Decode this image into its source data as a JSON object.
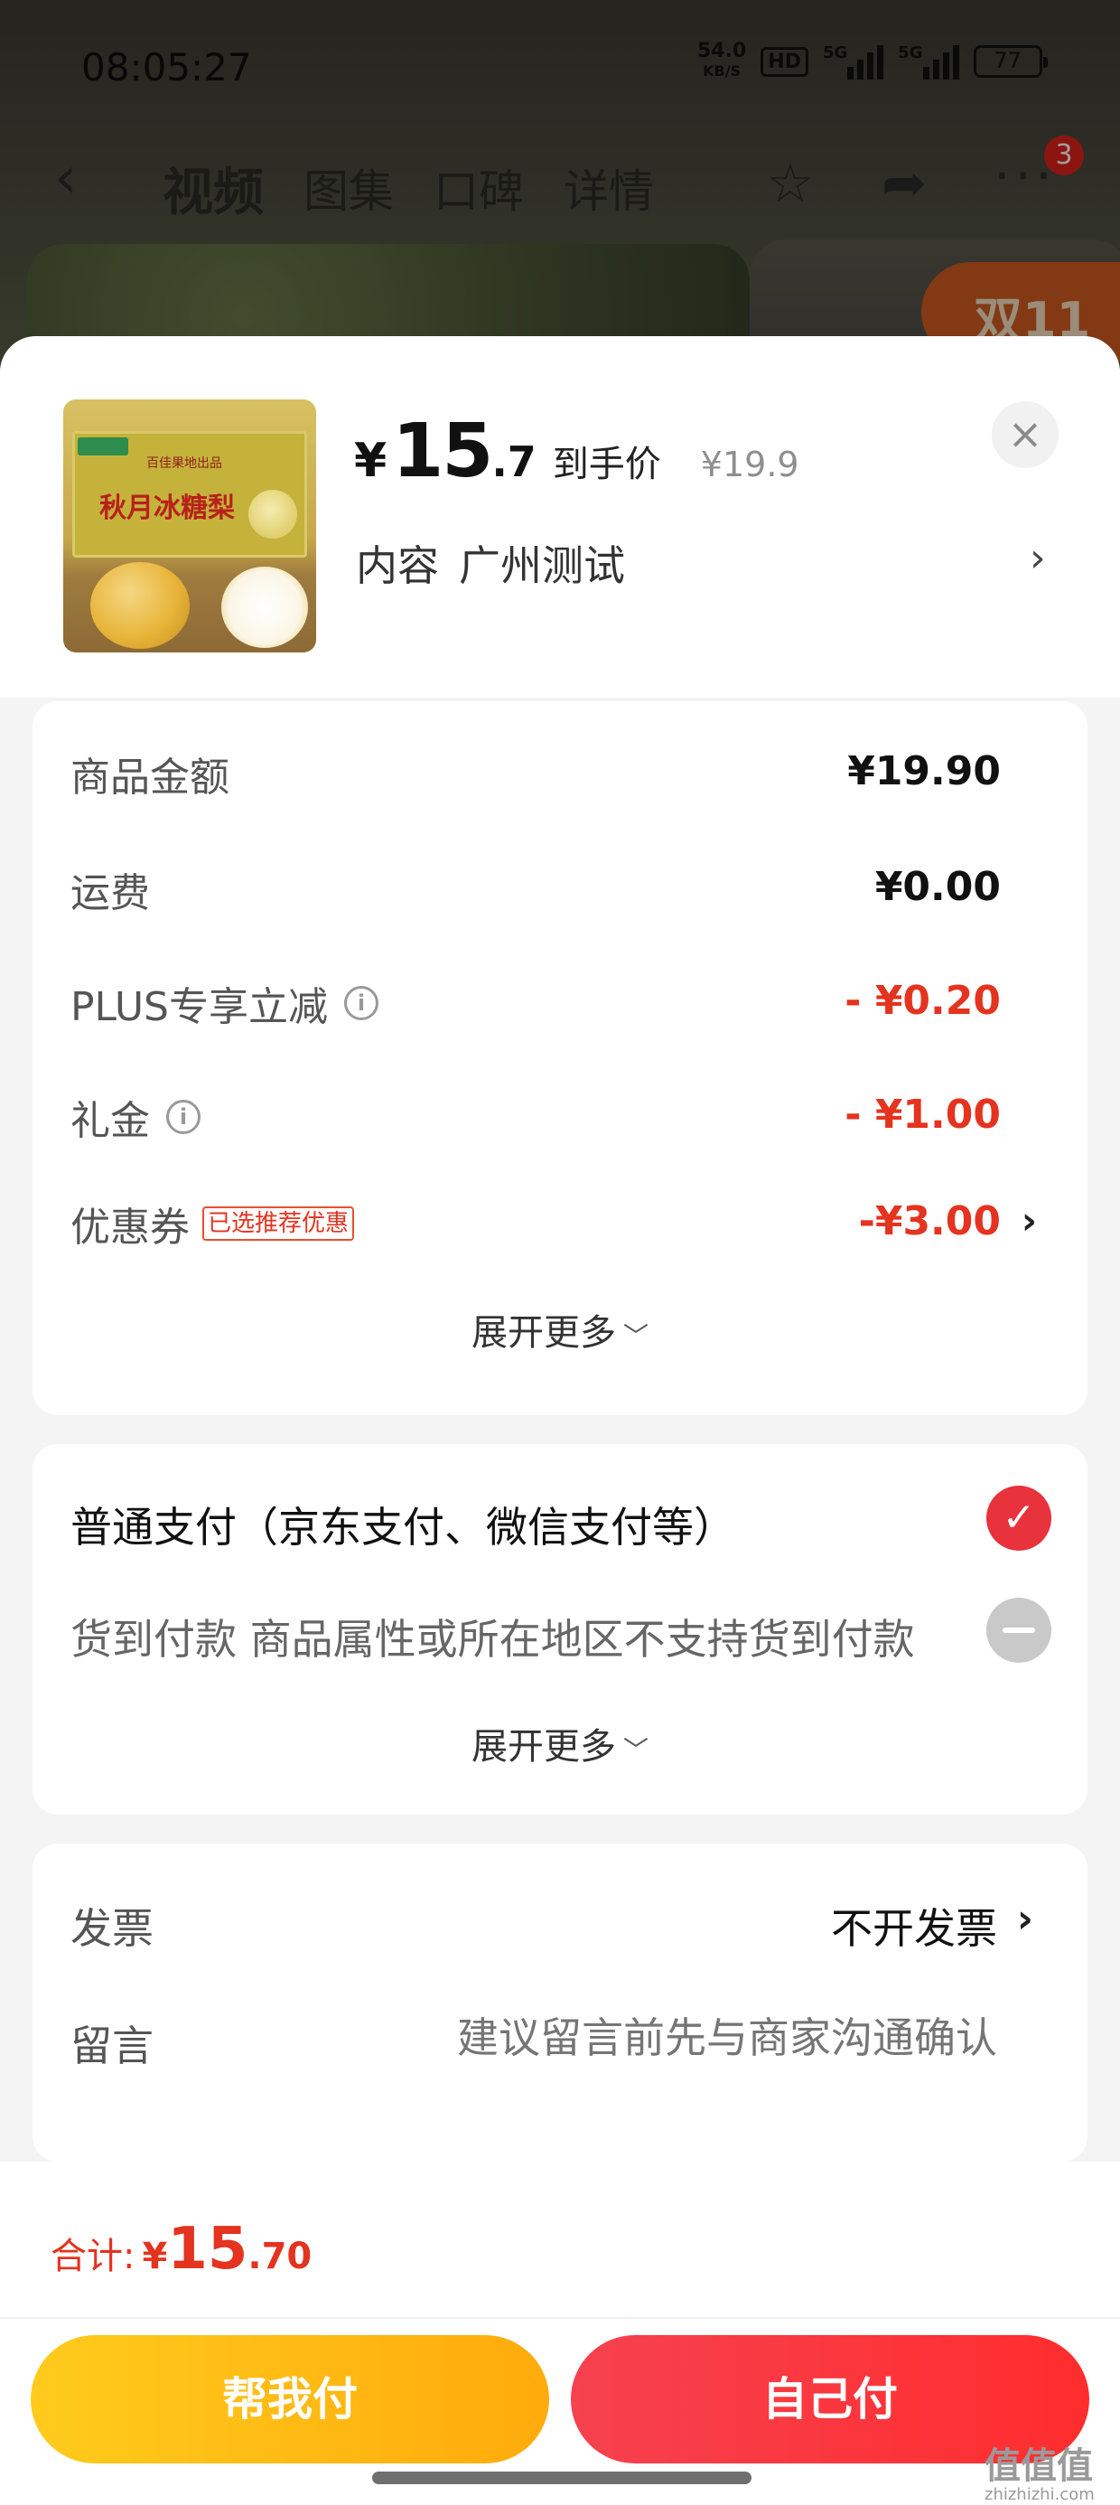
{
  "status_bar": {
    "time": "08:05:27",
    "net_speed": "54.0",
    "net_unit": "KB/S",
    "hd": "HD",
    "sig1": "5G",
    "sig2": "5G",
    "battery": "77"
  },
  "nav": {
    "tabs": [
      {
        "label": "视频"
      },
      {
        "label": "图集"
      },
      {
        "label": "口碑"
      },
      {
        "label": "详情"
      }
    ],
    "more_count": "3",
    "bg_badge": "双11"
  },
  "product": {
    "image_title": "秋月冰糖梨",
    "image_subtitle": "百佳果地出品",
    "price_symbol": "¥",
    "price_int": "15",
    "price_dec": ".7",
    "price_label": "到手价",
    "original_price": "¥19.9",
    "spec_label": "内容",
    "spec_value": "广州测试"
  },
  "summary": {
    "rows": [
      {
        "label": "商品金额",
        "value": "¥19.90"
      },
      {
        "label": "运费",
        "value": "¥0.00"
      },
      {
        "label": "PLUS专享立减",
        "value": "- ¥0.20"
      },
      {
        "label": "礼金",
        "value": "- ¥1.00"
      },
      {
        "label": "优惠券",
        "tag": "已选推荐优惠",
        "value": "-¥3.00"
      }
    ],
    "expand_label": "展开更多"
  },
  "payment": {
    "options": [
      {
        "label": "普通支付（京东支付、微信支付等）"
      },
      {
        "label": "货到付款 商品属性或所在地区不支持货到付款"
      }
    ],
    "expand_label": "展开更多"
  },
  "invoice": {
    "label": "发票",
    "value": "不开发票"
  },
  "message": {
    "label": "留言",
    "placeholder": "建议留言前先与商家沟通确认"
  },
  "footer": {
    "total_label": "合计:",
    "total_symbol": "¥",
    "total_int": "15",
    "total_dec": ".70",
    "help_pay_label": "帮我付",
    "self_pay_label": "自己付"
  },
  "watermark": {
    "main": "值值值",
    "sub": "zhizhizhi.com"
  }
}
